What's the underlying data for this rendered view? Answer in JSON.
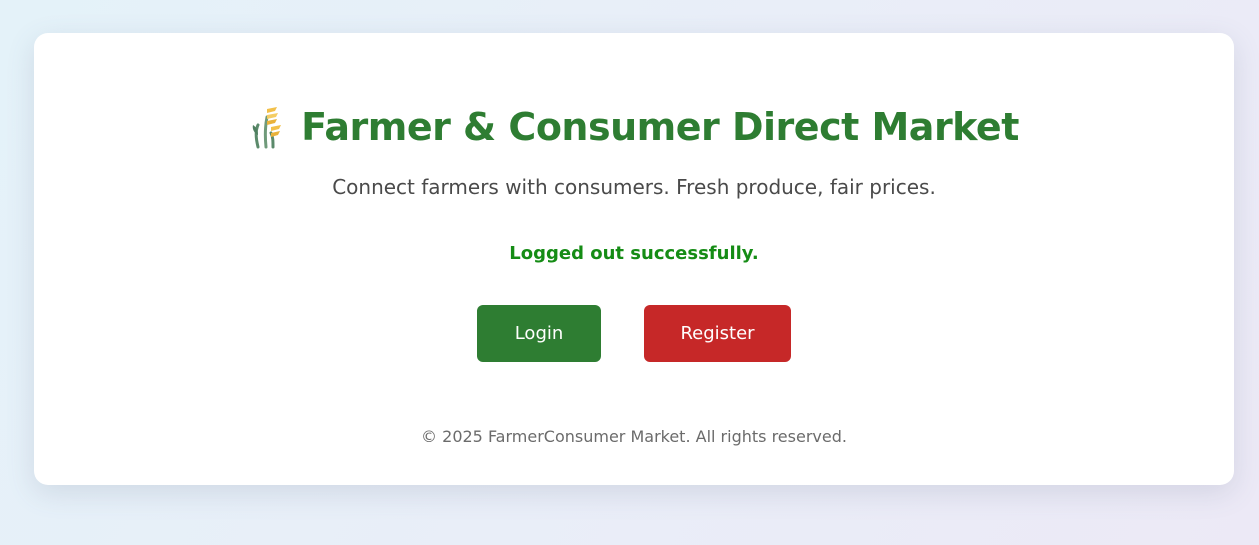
{
  "app": {
    "title": "Farmer & Consumer Direct Market",
    "logo_icon": "sheaf-of-rice-icon",
    "tagline": "Connect farmers with consumers. Fresh produce, fair prices."
  },
  "status": {
    "message": "Logged out successfully.",
    "color": "#158c15"
  },
  "actions": {
    "login_label": "Login",
    "register_label": "Register"
  },
  "footer": {
    "copyright": "© 2025 FarmerConsumer Market. All rights reserved."
  },
  "colors": {
    "brand_green": "#2e7d32",
    "register_red": "#c62828"
  }
}
